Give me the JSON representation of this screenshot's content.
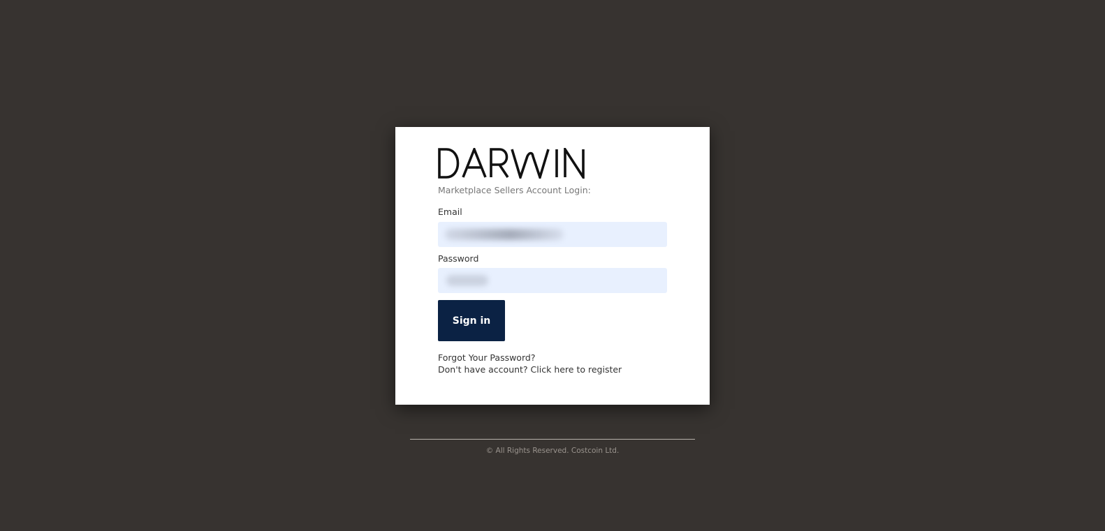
{
  "brand": {
    "logo_text": "DARWIN",
    "logo_color": "#111111"
  },
  "login": {
    "subtitle": "Marketplace Sellers Account Login:",
    "email_label": "Email",
    "email_value": "",
    "password_label": "Password",
    "password_value": "",
    "signin_label": "Sign in",
    "forgot_link": "Forgot Your Password?",
    "register_link": "Don't have account? Click here to register"
  },
  "footer": {
    "copyright": "© All Rights Reserved. Costcoin Ltd."
  },
  "colors": {
    "background": "#373330",
    "card": "#ffffff",
    "button": "#0b2244",
    "input_fill": "#e8f0fe"
  }
}
